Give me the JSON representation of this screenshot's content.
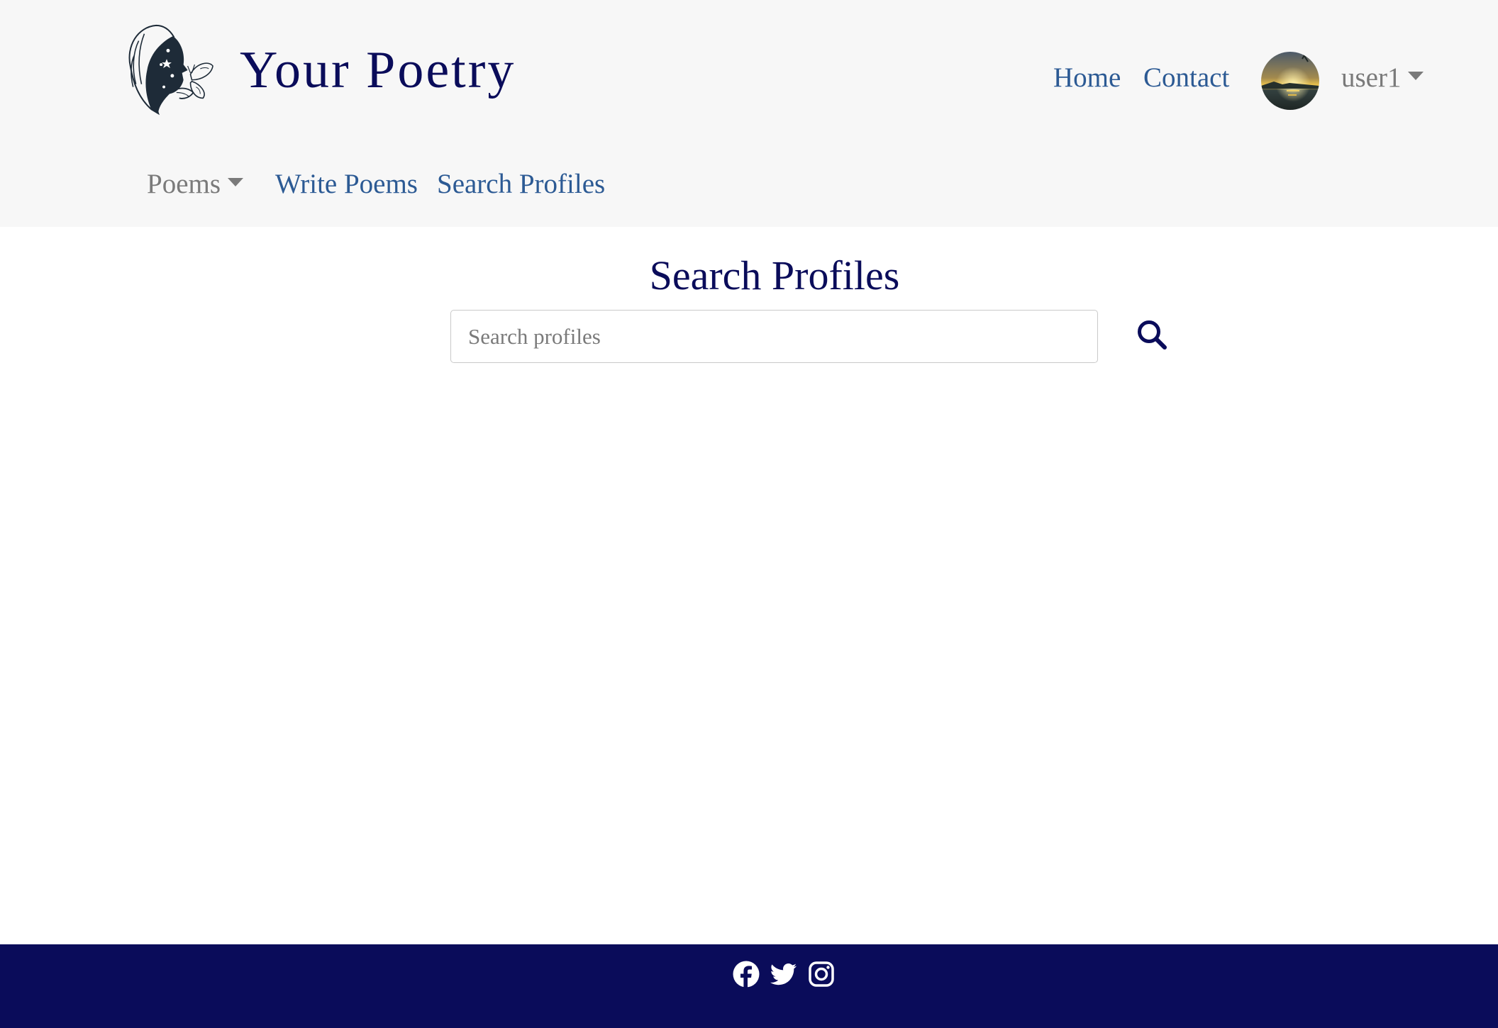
{
  "brand": {
    "name": "Your Poetry",
    "logo_icon": "woman-butterfly-logo-icon"
  },
  "nav": {
    "home": "Home",
    "contact": "Contact",
    "user": "user1",
    "avatar_icon": "sunset-avatar",
    "poems_menu": "Poems",
    "write_poems": "Write Poems",
    "search_profiles": "Search Profiles"
  },
  "main": {
    "title": "Search Profiles",
    "search": {
      "placeholder": "Search profiles",
      "value": "",
      "button_icon": "search-icon"
    }
  },
  "footer": {
    "social": [
      "facebook-icon",
      "twitter-icon",
      "instagram-icon"
    ]
  },
  "colors": {
    "brand_navy": "#0a0c5a",
    "link_blue": "#2c5a94",
    "muted_gray": "#7a7a7a",
    "header_bg": "#f7f7f7"
  }
}
